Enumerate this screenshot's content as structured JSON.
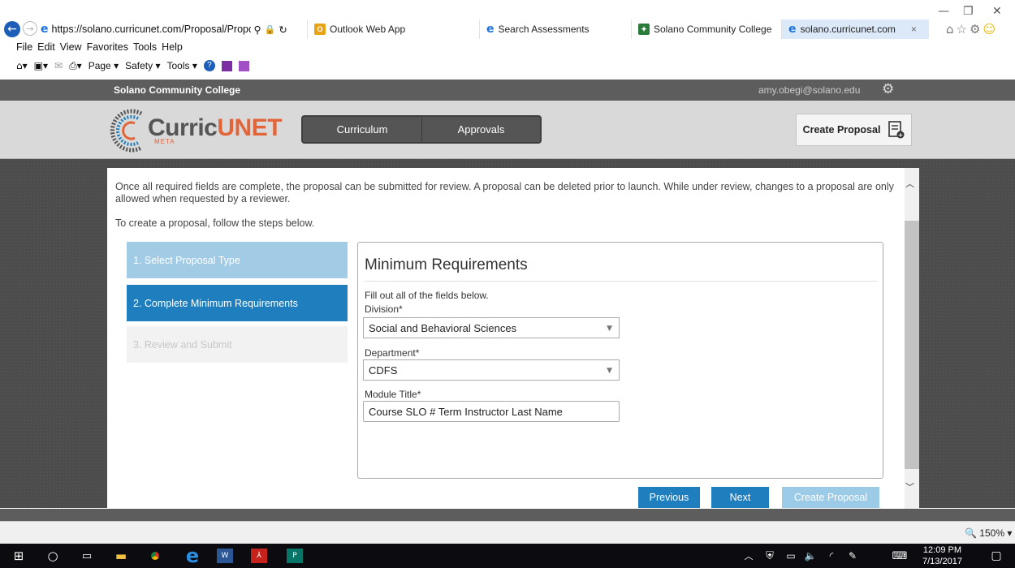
{
  "browser": {
    "url": "https://solano.curricunet.com/Proposal/Proposal",
    "tabs": [
      {
        "label": "Outlook Web App",
        "icon": "outlook-icon",
        "color": "#e8a317"
      },
      {
        "label": "Search Assessments",
        "icon": "ie-icon",
        "color": "#1e73d8"
      },
      {
        "label": "Solano Community College",
        "icon": "solano-icon",
        "color": "#2a7a3a"
      },
      {
        "label": "solano.curricunet.com",
        "icon": "ie-icon",
        "color": "#1e73d8",
        "active": true
      }
    ],
    "tab_close": "×",
    "menu": [
      "File",
      "Edit",
      "View",
      "Favorites",
      "Tools",
      "Help"
    ],
    "command_bar": [
      "Page ▾",
      "Safety ▾",
      "Tools ▾"
    ],
    "window_controls": {
      "minimize": "—",
      "restore": "❐",
      "close": "✕"
    },
    "zoom": "150%"
  },
  "site": {
    "brand": "Solano Community College",
    "user_email": "amy.obegi@solano.edu",
    "logo_main": "Curric",
    "logo_accent": "UNET",
    "logo_sub": "META",
    "nav": [
      "Curriculum",
      "Approvals"
    ],
    "create_proposal": "Create Proposal"
  },
  "page": {
    "intro": "Once all required fields are complete, the proposal can be submitted for review. A proposal can be deleted prior to launch. While under review, changes to a proposal are only allowed when requested by a reviewer.",
    "steps_intro": "To create a proposal, follow the steps below.",
    "steps": [
      {
        "label": "1. Select Proposal Type",
        "state": "done"
      },
      {
        "label": "2. Complete Minimum Requirements",
        "state": "active"
      },
      {
        "label": "3. Review and Submit",
        "state": "disabled"
      }
    ],
    "panel_title": "Minimum Requirements",
    "instructions": "Fill out all of the fields below.",
    "fields": {
      "division_label": "Division*",
      "division_value": "Social and Behavioral Sciences",
      "department_label": "Department*",
      "department_value": "CDFS",
      "module_label": "Module Title*",
      "module_value": "Course SLO # Term Instructor Last Name"
    },
    "buttons": {
      "previous": "Previous",
      "next": "Next",
      "create": "Create Proposal"
    }
  },
  "taskbar": {
    "time": "12:09 PM",
    "date": "7/13/2017"
  }
}
